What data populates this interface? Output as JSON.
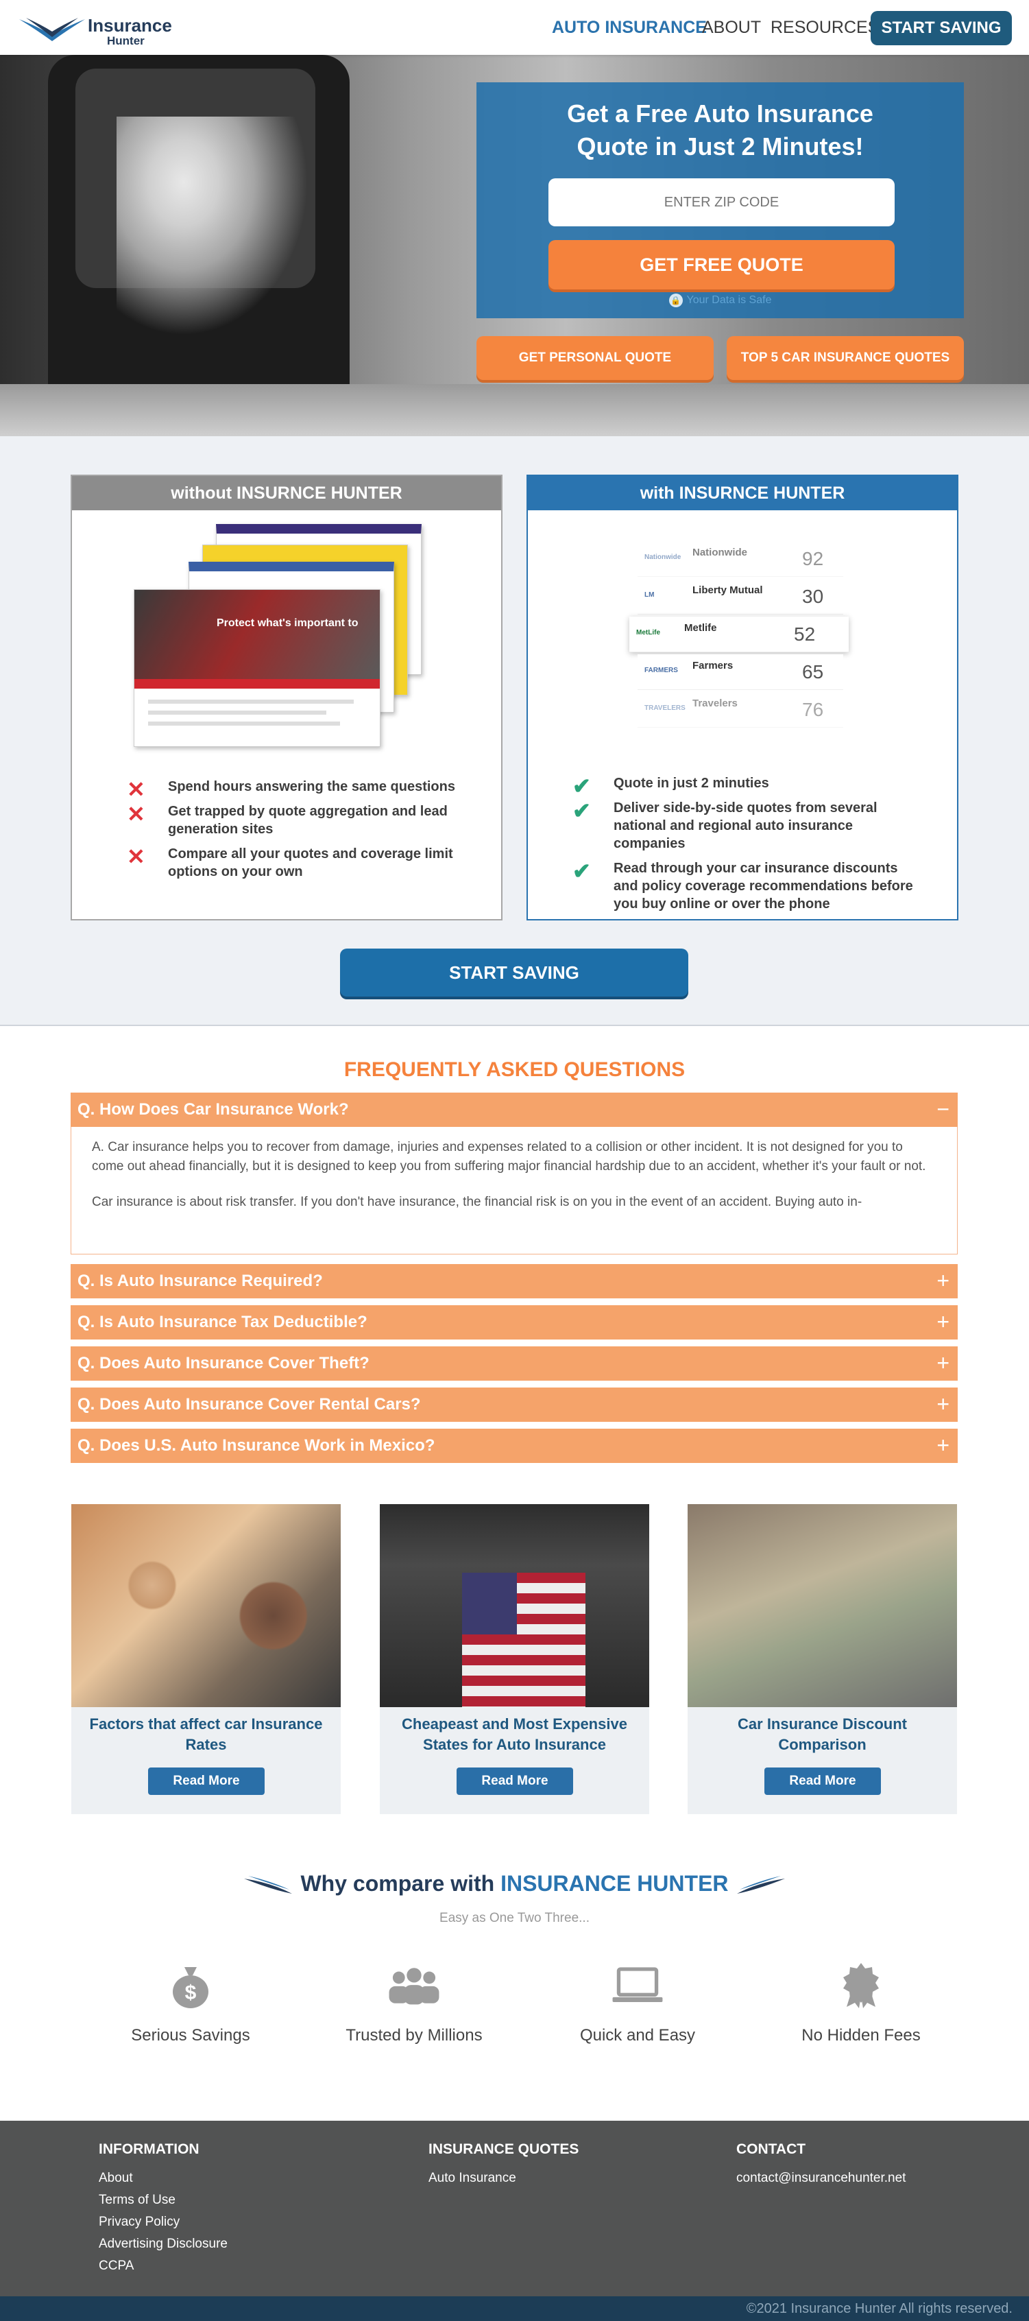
{
  "header": {
    "logo_line1": "Insurance",
    "logo_line2": "Hunter",
    "nav": [
      "AUTO INSURANCE",
      "ABOUT",
      "RESOURCES"
    ],
    "cta": "START SAVING"
  },
  "hero": {
    "title_line1": "Get a Free Auto Insurance",
    "title_line2": "Quote in Just 2 Minutes!",
    "zip_placeholder": "ENTER ZIP CODE",
    "quote_button": "GET FREE QUOTE",
    "safe_text": "Your Data is Safe",
    "btn_personal": "GET PERSONAL QUOTE",
    "btn_top5": "TOP 5  CAR INSURANCE QUOTES"
  },
  "compare": {
    "without_title": "without INSURNCE HUNTER",
    "with_title": "with INSURNCE HUNTER",
    "without_items": [
      "Spend hours answering the same questions",
      "Get trapped by quote aggregation and lead generation sites",
      "Compare all your quotes and coverage limit options on your own"
    ],
    "with_items": [
      "Quote in just 2 minuties",
      "Deliver side-by-side quotes from several national and regional auto insurance companies",
      "Read through your car insurance discounts and policy coverage recommendations before you buy online or over the phone"
    ],
    "quotes": [
      {
        "name": "Nationwide",
        "price": "92"
      },
      {
        "name": "Liberty Mutual",
        "price": "30"
      },
      {
        "name": "Metlife",
        "price": "52"
      },
      {
        "name": "Farmers",
        "price": "65"
      },
      {
        "name": "Travelers",
        "price": "76"
      }
    ],
    "shot_text": "Protect what's important to",
    "cta": "START SAVING"
  },
  "faq": {
    "title": "FREQUENTLY ASKED QUESTIONS",
    "open_question": "Q. How Does Car Insurance Work?",
    "open_answer_1": "A. Car insurance helps you to recover from damage, injuries and expenses related to a collision or other incident. It is not designed for you to come out ahead financially, but it is designed to keep you from suffering major financial hardship due to an accident, whether it's your fault or not.",
    "open_answer_2": "Car insurance is about risk transfer. If you don't have insurance, the financial risk is on you in the event of an accident. Buying auto in-",
    "questions": [
      "Q. Is Auto Insurance Required?",
      "Q. Is Auto Insurance Tax Deductible?",
      "Q. Does Auto Insurance Cover Theft?",
      "Q. Does Auto Insurance Cover Rental Cars?",
      "Q. Does U.S. Auto Insurance Work in Mexico?"
    ],
    "minus": "−",
    "plus": "+"
  },
  "articles": [
    {
      "title": "Factors that affect car Insurance Rates",
      "button": "Read More"
    },
    {
      "title": "Cheapeast and Most Expensive States for Auto Insurance",
      "button": "Read More"
    },
    {
      "title": "Car Insurance Discount Comparison",
      "button": "Read More"
    }
  ],
  "why": {
    "title_prefix": "Why compare with ",
    "title_highlight": "INSURANCE HUNTER",
    "subtitle": "Easy as One Two Three...",
    "features": [
      "Serious Savings",
      "Trusted by Millions",
      "Quick and Easy",
      "No Hidden Fees"
    ]
  },
  "footer": {
    "info_title": "INFORMATION",
    "info_links": [
      "About",
      "Terms of Use",
      "Privacy Policy",
      "Advertising Disclosure",
      "CCPA"
    ],
    "quotes_title": "INSURANCE QUOTES",
    "quotes_links": [
      "Auto Insurance"
    ],
    "contact_title": "CONTACT",
    "contact_email": "contact@insurancehunter.net",
    "copyright": "©2021 Insurance Hunter All rights reserved."
  },
  "colors": {
    "brand_blue": "#2a74b0",
    "brand_navy": "#253c5a",
    "accent_orange": "#f5823c"
  }
}
